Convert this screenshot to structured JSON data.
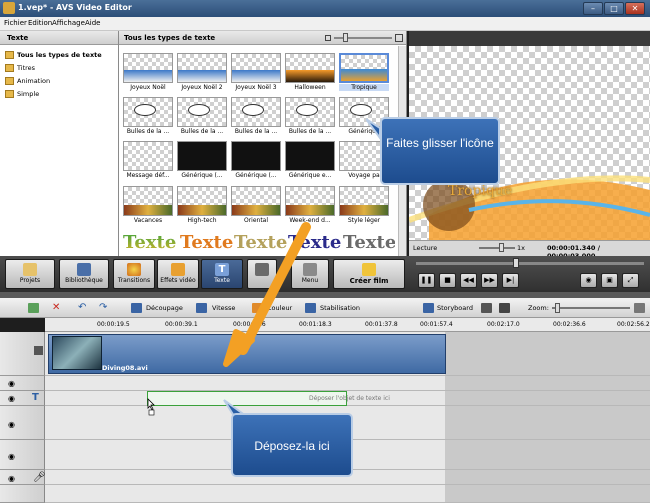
{
  "window": {
    "title": "1.vep* - AVS Video Editor"
  },
  "menu": [
    "Fichier",
    "Edition",
    "Affichage",
    "Aide"
  ],
  "left_panel": {
    "header": "Texte",
    "items": [
      "Tous les types de texte",
      "Titres",
      "Animation",
      "Simple"
    ]
  },
  "mid_panel": {
    "header": "Tous les types de texte",
    "thumbs": [
      "Joyeux Noël",
      "Joyeux Noël 2",
      "Joyeux Noël 3",
      "Halloween",
      "Tropique",
      "Bulles de la ...",
      "Bulles de la ...",
      "Bulles de la ...",
      "Bulles de la ...",
      "Générique",
      "Message déf...",
      "Générique (...",
      "Générique (...",
      "Générique e...",
      "Voyage pa",
      "Vacances",
      "High-tech",
      "Oriental",
      "Week-end d...",
      "Style léger"
    ],
    "text_samples": [
      "Texte",
      "Texte",
      "Texte",
      "Texte",
      "Texte"
    ]
  },
  "preview": {
    "overlay_text": "Tropique",
    "label": "Lecture",
    "speed": "1x",
    "time": "00:00:01.340 / 00:00:03.000"
  },
  "toolbar": [
    "Projets",
    "Bibliothèque",
    "Transitions",
    "Effets vidéo",
    "Texte",
    "",
    "Menu",
    "Créer film"
  ],
  "timeline_toolbar": {
    "cut": "Découpage",
    "speed": "Vitesse",
    "color": "Couleur",
    "stabilize": "Stabilisation",
    "storyboard": "Storyboard",
    "zoom": "Zoom:"
  },
  "ruler": [
    "00:00:19.5",
    "00:00:39.1",
    "00:00:58.6",
    "00:01:18.3",
    "00:01:37.8",
    "00:01:57.4",
    "00:02:17.0",
    "00:02:36.6",
    "00:02:56.2"
  ],
  "video_clip": {
    "name": "Diving08.avi"
  },
  "text_track": {
    "placeholder": "Déposer l'objet de texte ici"
  },
  "callouts": {
    "drag": "Faites glisser l'icône",
    "drop": "Déposez-la ici"
  },
  "colors": {
    "accent": "#2d5a9c",
    "arrow": "#f3a024",
    "callout": "#2a5fa6"
  }
}
